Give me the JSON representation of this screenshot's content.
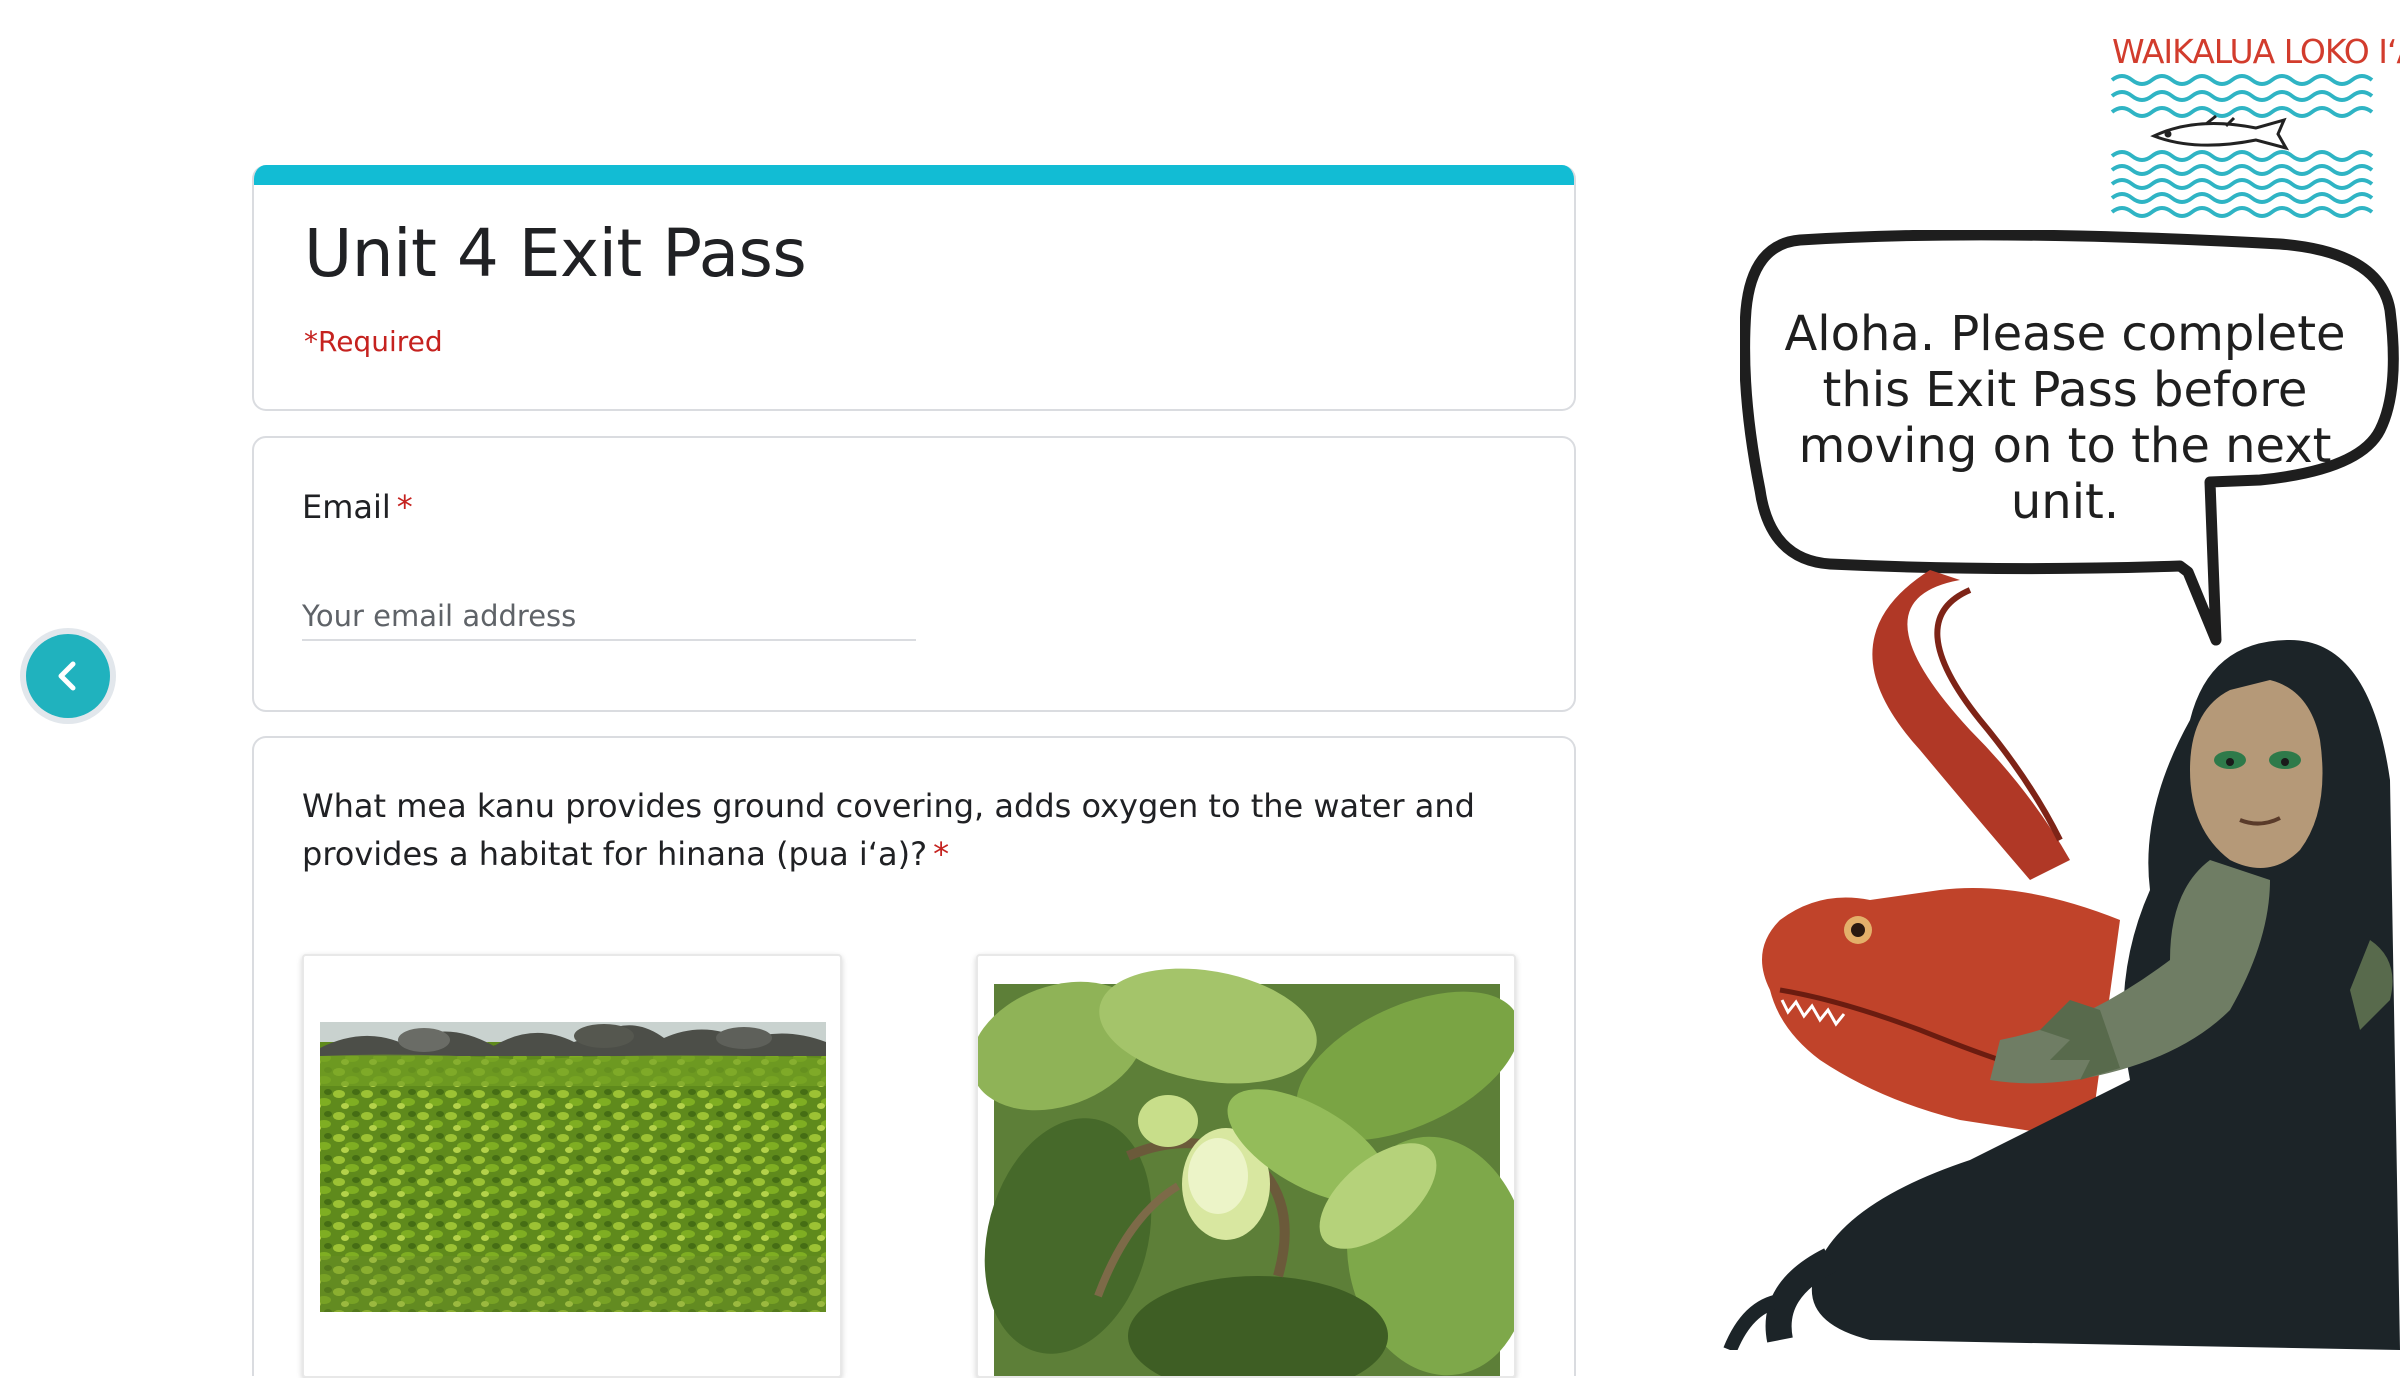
{
  "form": {
    "title": "Unit 4 Exit Pass",
    "required_note": "*Required",
    "accent_color": "#12bcd4"
  },
  "email": {
    "label": "Email",
    "required_marker": "*",
    "placeholder": "Your email address"
  },
  "question": {
    "text": "What mea kanu provides ground covering, adds oxygen to the water and provides a habitat for hinana (pua iʻa)?",
    "required_marker": "*",
    "options": [
      {
        "image": "ground-cover-plant-photo"
      },
      {
        "image": "noni-fruit-photo"
      }
    ]
  },
  "logo": {
    "text": "WAIKALUA LOKO IʻA"
  },
  "speech_bubble": {
    "text": "Aloha. Please complete this Exit Pass before moving on to the next unit."
  },
  "navigation": {
    "prev_icon": "chevron-left-icon",
    "next_icon": "chevron-right-icon",
    "button_color": "#20b2be"
  }
}
